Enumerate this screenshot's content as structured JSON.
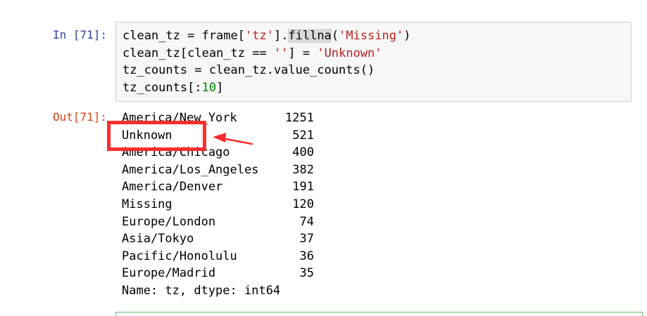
{
  "input_prompt": "In [71]:",
  "output_prompt": "Out[71]:",
  "code": {
    "line1": {
      "a": "clean_tz = frame[",
      "b": "'tz'",
      "c": "].",
      "d": "fillna",
      "e": "(",
      "f": "'Missing'",
      "g": ")"
    },
    "line2": {
      "a": "clean_tz[clean_tz == ",
      "b": "''",
      "c": "] = ",
      "d": "'Unknown'"
    },
    "line3": "tz_counts = clean_tz.value_counts()",
    "line4": {
      "a": "tz_counts[:",
      "b": "10",
      "c": "]"
    }
  },
  "output": {
    "rows": [
      {
        "name": "America/New_York",
        "count": "1251"
      },
      {
        "name": "Unknown",
        "count": "521"
      },
      {
        "name": "America/Chicago",
        "count": "400"
      },
      {
        "name": "America/Los_Angeles",
        "count": "382"
      },
      {
        "name": "America/Denver",
        "count": "191"
      },
      {
        "name": "Missing",
        "count": "120"
      },
      {
        "name": "Europe/London",
        "count": "74"
      },
      {
        "name": "Asia/Tokyo",
        "count": "37"
      },
      {
        "name": "Pacific/Honolulu",
        "count": "36"
      },
      {
        "name": "Europe/Madrid",
        "count": "35"
      }
    ],
    "dtype_line": "Name: tz, dtype: int64"
  },
  "annotation_color": "#ff2d2d",
  "icons": {
    "annotation": "arrow-left-icon"
  }
}
